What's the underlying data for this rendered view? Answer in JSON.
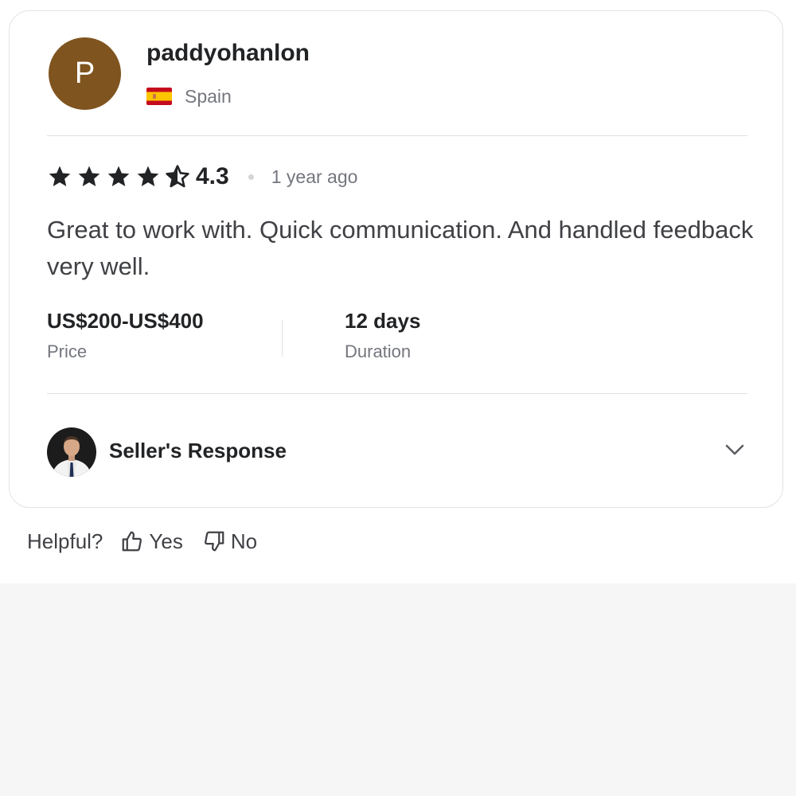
{
  "reviewer": {
    "initial": "P",
    "avatar_color": "#7f541f",
    "username": "paddyohanlon",
    "country": "Spain",
    "flag_icon": "spain-flag-icon"
  },
  "review": {
    "rating": 4.3,
    "rating_text": "4.3",
    "time_ago": "1 year ago",
    "text": "Great to work with. Quick communication. And handled feedback very well.",
    "price_value": "US$200-US$400",
    "price_label": "Price",
    "duration_value": "12 days",
    "duration_label": "Duration"
  },
  "seller_response": {
    "title": "Seller's Response",
    "expand_icon": "chevron-down-icon"
  },
  "helpful": {
    "label": "Helpful?",
    "yes_label": "Yes",
    "no_label": "No",
    "yes_icon": "thumbs-up-icon",
    "no_icon": "thumbs-down-icon"
  },
  "colors": {
    "text_primary": "#222325",
    "text_secondary": "#74767e",
    "star": "#222325",
    "page_background": "#f6f6f7"
  }
}
